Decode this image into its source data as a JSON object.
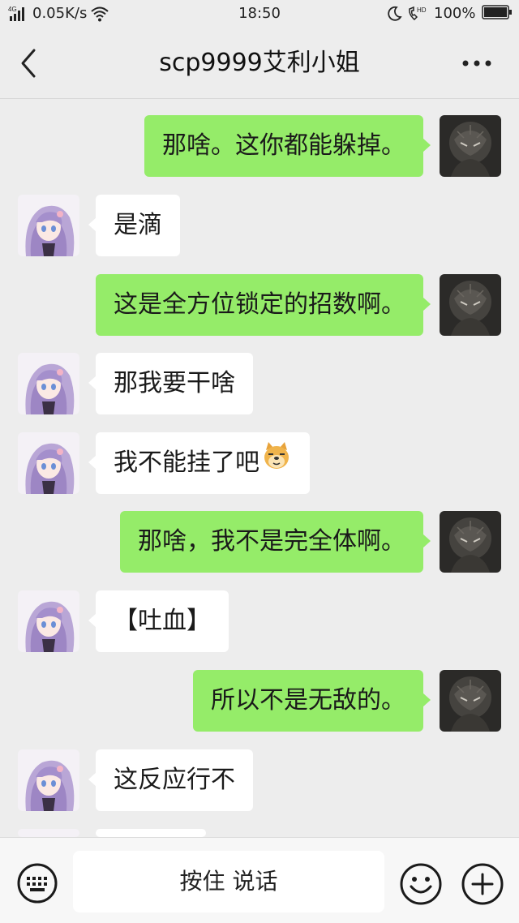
{
  "status_bar": {
    "network": "4G",
    "speed": "0.05K/s",
    "time": "18:50",
    "battery": "100%",
    "icons": [
      "signal-icon",
      "wifi-icon",
      "moon-icon",
      "hd-call-icon",
      "battery-icon"
    ]
  },
  "header": {
    "title": "scp9999艾利小姐",
    "back_icon": "chevron-left-icon",
    "more_icon": "more-dots-icon"
  },
  "messages": [
    {
      "side": "right",
      "text": "那啥。这你都能躲掉。"
    },
    {
      "side": "left",
      "text": "是滴"
    },
    {
      "side": "right",
      "text": "这是全方位锁定的招数啊。"
    },
    {
      "side": "left",
      "text": "那我要干啥"
    },
    {
      "side": "left",
      "text": "我不能挂了吧",
      "emoji": "doge-emoji"
    },
    {
      "side": "right",
      "text": "那啥，我不是完全体啊。"
    },
    {
      "side": "left",
      "text": "【吐血】"
    },
    {
      "side": "right",
      "text": "所以不是无敌的。"
    },
    {
      "side": "left",
      "text": "这反应行不"
    }
  ],
  "input_bar": {
    "voice_label": "按住 说话",
    "icons": [
      "keyboard-icon",
      "emoji-icon",
      "plus-icon"
    ]
  },
  "colors": {
    "background": "#ededed",
    "outgoing_bubble": "#95ec69",
    "incoming_bubble": "#ffffff"
  }
}
